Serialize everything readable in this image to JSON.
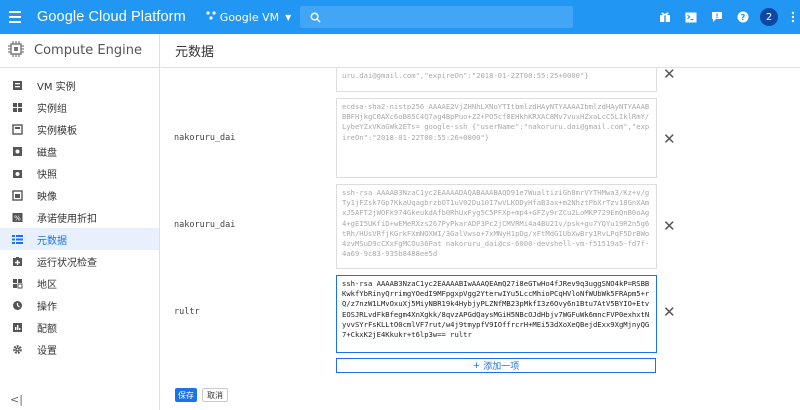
{
  "topbar": {
    "brand": "Google Cloud Platform",
    "project": "Google VM",
    "avatar_letter": "2",
    "icons": [
      "gift-icon",
      "terminal-icon",
      "alert-icon",
      "help-icon",
      "more-vert-icon"
    ]
  },
  "sidebar": {
    "title": "Compute Engine",
    "items": [
      {
        "label": "VM 实例",
        "icon": "vm-instance-icon"
      },
      {
        "label": "实例组",
        "icon": "instance-group-icon"
      },
      {
        "label": "实例模板",
        "icon": "instance-template-icon"
      },
      {
        "label": "磁盘",
        "icon": "disk-icon"
      },
      {
        "label": "快照",
        "icon": "snapshot-icon"
      },
      {
        "label": "映像",
        "icon": "image-icon"
      },
      {
        "label": "承诺使用折扣",
        "icon": "percent-icon"
      },
      {
        "label": "元数据",
        "icon": "metadata-icon",
        "active": true
      },
      {
        "label": "运行状况检查",
        "icon": "health-check-icon"
      },
      {
        "label": "地区",
        "icon": "zone-icon"
      },
      {
        "label": "操作",
        "icon": "operations-icon"
      },
      {
        "label": "配额",
        "icon": "quota-icon"
      },
      {
        "label": "设置",
        "icon": "settings-icon"
      }
    ],
    "collapse": "<|"
  },
  "main": {
    "title": "元数据",
    "rows": [
      {
        "label": "",
        "key": "uru.dai@gmail.com\",\"expireOn\":\"2018-01-22T00:55:25+0000\"}"
      },
      {
        "label": "nakoruru_dai",
        "key": "ecdsa-sha2-nistp256 AAAAE2VjZHNhLXNoYTItbmlzdHAyNTYAAAAIbmlzdHAyNTYAAABBBFHjkgC0AXc6oB85C4Q7ag4BpPuo+Z2+PO5cf8EHkhKRXAC8Mv7vuxHZxaLcC5LIklRmY/LybeYZxVKaGWk2ETs= google-ssh {\"userName\":\"nakoruru.dai@gmail.com\",\"expireOn\":\"2018-01-22T00:55:26+0000\"}"
      },
      {
        "label": "nakoruru_dai",
        "key": "ssh-rsa AAAAB3NzaC1yc2EAAAADAQABAAABAQD91e7WualtiziGh8mrVYTHMwa3/Kz+v/gTy1jFZsk7Gp7KkaUqagbrzbOT1uV02Du10I7wVLKODyHfaB3ax+m2NhztPbXrTzv18GnXAmxJ5AFT2jWOFk974GkeukdAfb0RhUxFyg5C5PFXp+mp4+GFZy9rZCu2LoMKP729EmQnB0oAg4+gEI5UKfiD+wEMeRXzs267PyPkarADP3Pc2jCMVRMi4a4BU21v/psk+gu7YQYu19R2n5g6tRh/HUsVRfjKGrkFXmNOXWI/3GalVwso+7xMNyH1pDg/xFtMdG1UbXwBry1RvLPqF5DrBWo4zvMSuD9cCXxFgMCOu36Pat nakoruru_dai@cs-6000-devshell-vm-f51519a5-fd7f-4a69-9c83-935b8488ee5d"
      },
      {
        "label": "rultr",
        "key": "ssh-rsa AAAAB3NzaC1yc2EAAAABIwAAAQEAmQ27i8eGTwHo4fJRev9q3uggSNO4kP=RSBBKwkfYbRinyQrrimgYOedI9MFpgxpVgg2YterwIYu5LccMhioPCqHVloNfWUbWk5FRApm5+rQ/z7nzW1LMvOxuXj5MiyNBR19k4HybjyPLZNfMB23pMkfI3z6Ovy6n1Btu7AtV5BYIO+EtvEOSJRLvdFkBfegm4XnXgkk/8qvzAPGdQaysMGiH5NBcOJdHbjv7WGFuWk6mncFVP0exhxtNyvvSYrFsKLLtO0cmlVF7rut/w4j9tmypfV9IOffrcrH+MEi53dXoXeQBejdExx9XgMjnyQG7+CkxK2jE4Kkukr+t6lp3w== rultr"
      }
    ],
    "add_label": "添加一项",
    "save_label": "保存",
    "cancel_label": "取消"
  }
}
